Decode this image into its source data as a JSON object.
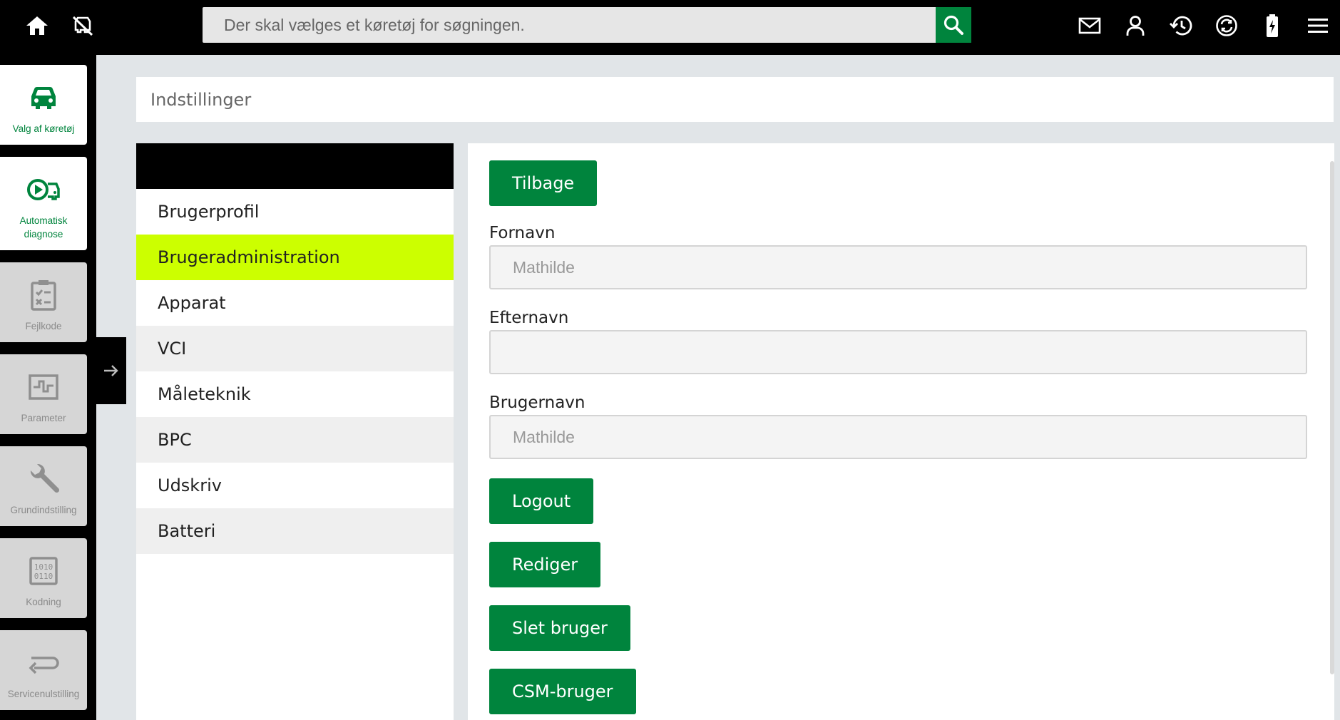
{
  "topbar": {
    "search_placeholder": "Der skal vælges et køretøj for søgningen.",
    "icons": [
      "home-icon",
      "no-vehicle-icon",
      "search-icon",
      "mail-icon",
      "user-icon",
      "history-icon",
      "sync-icon",
      "battery-icon",
      "menu-icon"
    ]
  },
  "sidebar": {
    "items": [
      {
        "label": "Valg af køretøj",
        "icon": "car-icon",
        "state": "active"
      },
      {
        "label": "Automatisk diagnose",
        "icon": "auto-diagnosis-icon",
        "state": "active"
      },
      {
        "label": "Fejlkode",
        "icon": "checklist-icon",
        "state": "disabled"
      },
      {
        "label": "Parameter",
        "icon": "parameter-icon",
        "state": "disabled"
      },
      {
        "label": "Grundindstilling",
        "icon": "wrench-icon",
        "state": "disabled"
      },
      {
        "label": "Kodning",
        "icon": "binary-icon",
        "state": "disabled"
      },
      {
        "label": "Servicenulstilling",
        "icon": "return-arrow-icon",
        "state": "disabled"
      }
    ]
  },
  "header": {
    "title": "Indstillinger"
  },
  "menu": {
    "items": [
      {
        "label": "Brugerprofil"
      },
      {
        "label": "Brugeradministration"
      },
      {
        "label": "Apparat"
      },
      {
        "label": "VCI"
      },
      {
        "label": "Måleteknik"
      },
      {
        "label": "BPC"
      },
      {
        "label": "Udskriv"
      },
      {
        "label": "Batteri"
      }
    ],
    "active_index": 1
  },
  "form": {
    "back_label": "Tilbage",
    "firstname_label": "Fornavn",
    "firstname_value": "Mathilde",
    "lastname_label": "Efternavn",
    "lastname_value": "",
    "username_label": "Brugernavn",
    "username_value": "Mathilde",
    "logout_label": "Logout",
    "edit_label": "Rediger",
    "delete_label": "Slet bruger",
    "csm_label": "CSM-bruger"
  },
  "colors": {
    "brand_green": "#00843d",
    "active_highlight": "#ccff00",
    "topbar": "#000000"
  }
}
